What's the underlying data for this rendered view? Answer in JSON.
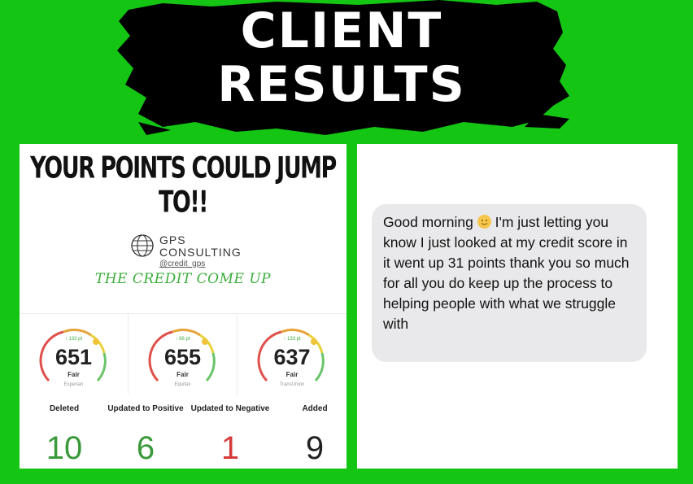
{
  "banner": {
    "title_line1": "CLIENT",
    "title_line2": "RESULTS"
  },
  "left_panel": {
    "headline": "YOUR POINTS COULD JUMP TO!!",
    "logo": {
      "line1": "GPS",
      "line2": "CONSULTING",
      "handle": "@credit_gps",
      "icon": "globe-icon"
    },
    "tagline": "THE CREDIT COME UP",
    "gauges": [
      {
        "score": "651",
        "rating": "Fair",
        "bureau": "Experian",
        "change": "↑ 133 pt"
      },
      {
        "score": "655",
        "rating": "Fair",
        "bureau": "Equifax",
        "change": "↑ 86 pt"
      },
      {
        "score": "637",
        "rating": "Fair",
        "bureau": "TransUnion",
        "change": "↑ 133 pt"
      }
    ],
    "stats": [
      {
        "label": "Deleted",
        "value": "10",
        "color": "#3a9a3a"
      },
      {
        "label": "Updated to Positive",
        "value": "6",
        "color": "#3a9a3a"
      },
      {
        "label": "Updated to Negative",
        "value": "1",
        "color": "#d63a3a"
      },
      {
        "label": "Added",
        "value": "9",
        "color": "#222222"
      }
    ]
  },
  "right_panel": {
    "message_before_emoji": "Good morning ",
    "emoji": "smiling-face-emoji",
    "message_after_emoji": " I'm just letting you know I just looked at my credit score in it went up 31 points thank you so much for all you do keep up the process to helping people with what we struggle with"
  },
  "colors": {
    "background": "#14c514",
    "banner": "#000000",
    "positive": "#3a9a3a",
    "negative": "#d63a3a"
  }
}
